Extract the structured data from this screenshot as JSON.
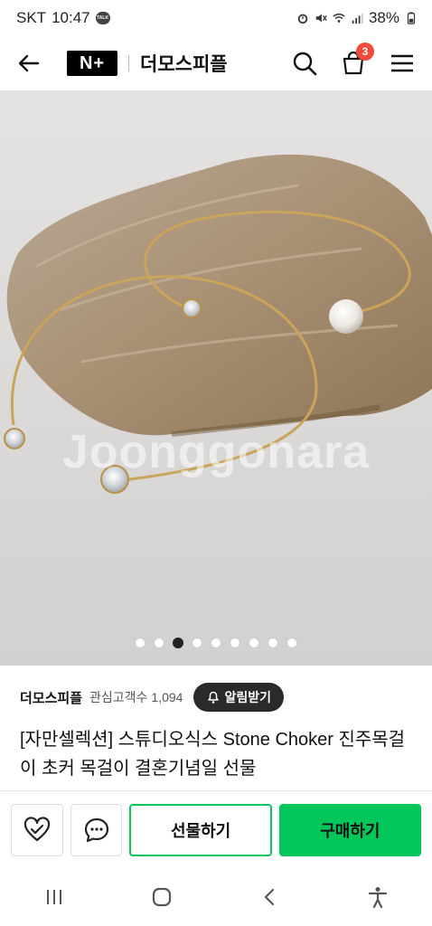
{
  "status": {
    "carrier": "SKT",
    "time": "10:47",
    "talk": "TALK",
    "battery": "38%"
  },
  "header": {
    "brand_badge": "N+",
    "store_name": "더모스피플",
    "cart_count": "3"
  },
  "gallery": {
    "watermark": "Joonggonara",
    "total_images": 9,
    "active_index": 2
  },
  "seller": {
    "name": "더모스피플",
    "followers_label": "관심고객수",
    "followers_count": "1,094",
    "alarm_label": "알림받기"
  },
  "product": {
    "title": "[자만셀렉션] 스튜디오식스 Stone Choker 진주목걸이 초커 목걸이 결혼기념일 선물"
  },
  "actions": {
    "gift_label": "선물하기",
    "buy_label": "구매하기"
  },
  "colors": {
    "accent": "#03c75a",
    "badge": "#f04a3b"
  }
}
